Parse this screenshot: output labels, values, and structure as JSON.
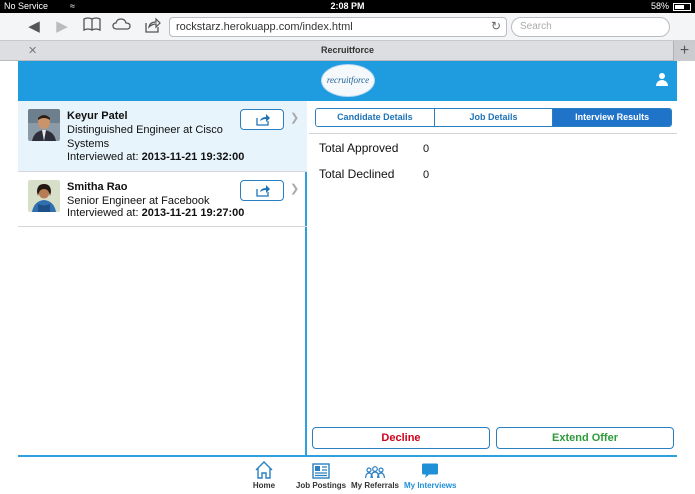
{
  "statusbar": {
    "carrier": "No Service",
    "time": "2:08 PM",
    "battery": "58%"
  },
  "browser": {
    "url": "rockstarz.herokuapp.com/index.html",
    "search_placeholder": "Search",
    "tab_title": "Recruitforce"
  },
  "app": {
    "logo_text": "recruitforce"
  },
  "candidates": [
    {
      "name": "Keyur Patel",
      "title": "Distinguished Engineer at Cisco Systems",
      "interviewed_label": "Interviewed at:",
      "interviewed_at": "2013-11-21 19:32:00"
    },
    {
      "name": "Smitha Rao",
      "title": "Senior Engineer at Facebook",
      "interviewed_label": "Interviewed at:",
      "interviewed_at": "2013-11-21 19:27:00"
    }
  ],
  "detail": {
    "tabs": [
      "Candidate Details",
      "Job Details",
      "Interview Results"
    ],
    "active_tab": "Interview Results",
    "stats": [
      {
        "label": "Total Approved",
        "value": "0"
      },
      {
        "label": "Total Declined",
        "value": "0"
      }
    ],
    "decline_label": "Decline",
    "extend_label": "Extend Offer",
    "decline_color": "#d0021b",
    "extend_color": "#2e9b3a"
  },
  "bottom_nav": [
    {
      "label": "Home",
      "icon": "home-icon"
    },
    {
      "label": "Job Postings",
      "icon": "job-postings-icon"
    },
    {
      "label": "My Referrals",
      "icon": "referrals-icon"
    },
    {
      "label": "My Interviews",
      "icon": "interviews-icon",
      "active": true
    }
  ],
  "colors": {
    "accent": "#1f9ce0",
    "active_tab": "#1f73c9"
  }
}
